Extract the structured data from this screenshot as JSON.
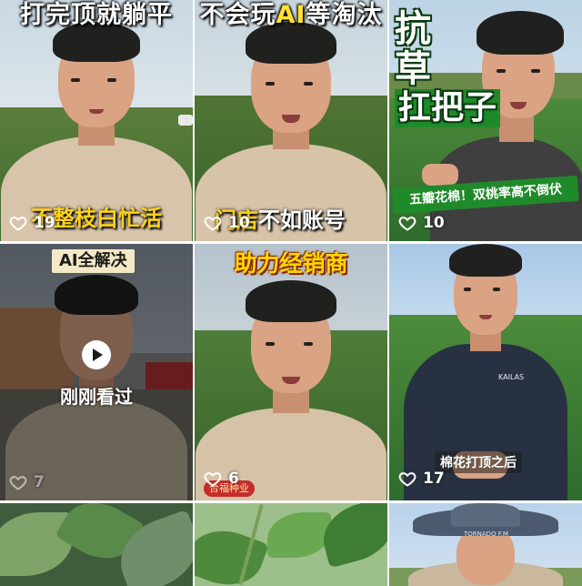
{
  "feed": {
    "videos": [
      {
        "id_label": "video-1",
        "top_caption": "打完顶就躺平",
        "bottom_caption_part1": "不整枝白忙活",
        "likes": "19"
      },
      {
        "top_caption_part1": "不会玩",
        "top_caption_hl": "AI",
        "top_caption_part2": "等淘汰",
        "bottom_caption_part1": "门店",
        "bottom_caption_part2": "不如账号",
        "likes": "10"
      },
      {
        "title_line1": "抗",
        "title_line2": "草",
        "title_line3": "扛把子",
        "banner": "五瓣花棉！双桃率高不倒伏",
        "likes": "10"
      },
      {
        "badge": "AI全解决",
        "watched_label": "刚刚看过",
        "likes": "7"
      },
      {
        "top_caption": "助力经销商",
        "logo_text": "合福种业",
        "likes": "6"
      },
      {
        "sub_caption": "棉花打顶之后",
        "jacket_logo": "KAILAS",
        "likes": "17"
      },
      {
        "scene": "cotton-leaves"
      },
      {
        "scene": "cotton-plant"
      },
      {
        "hat_brand": "TORNADO F.M"
      }
    ]
  },
  "colors": {
    "caption_yellow": "#ffd700",
    "banner_green": "#1f8a2a",
    "field_green": "#2f6b2c"
  }
}
